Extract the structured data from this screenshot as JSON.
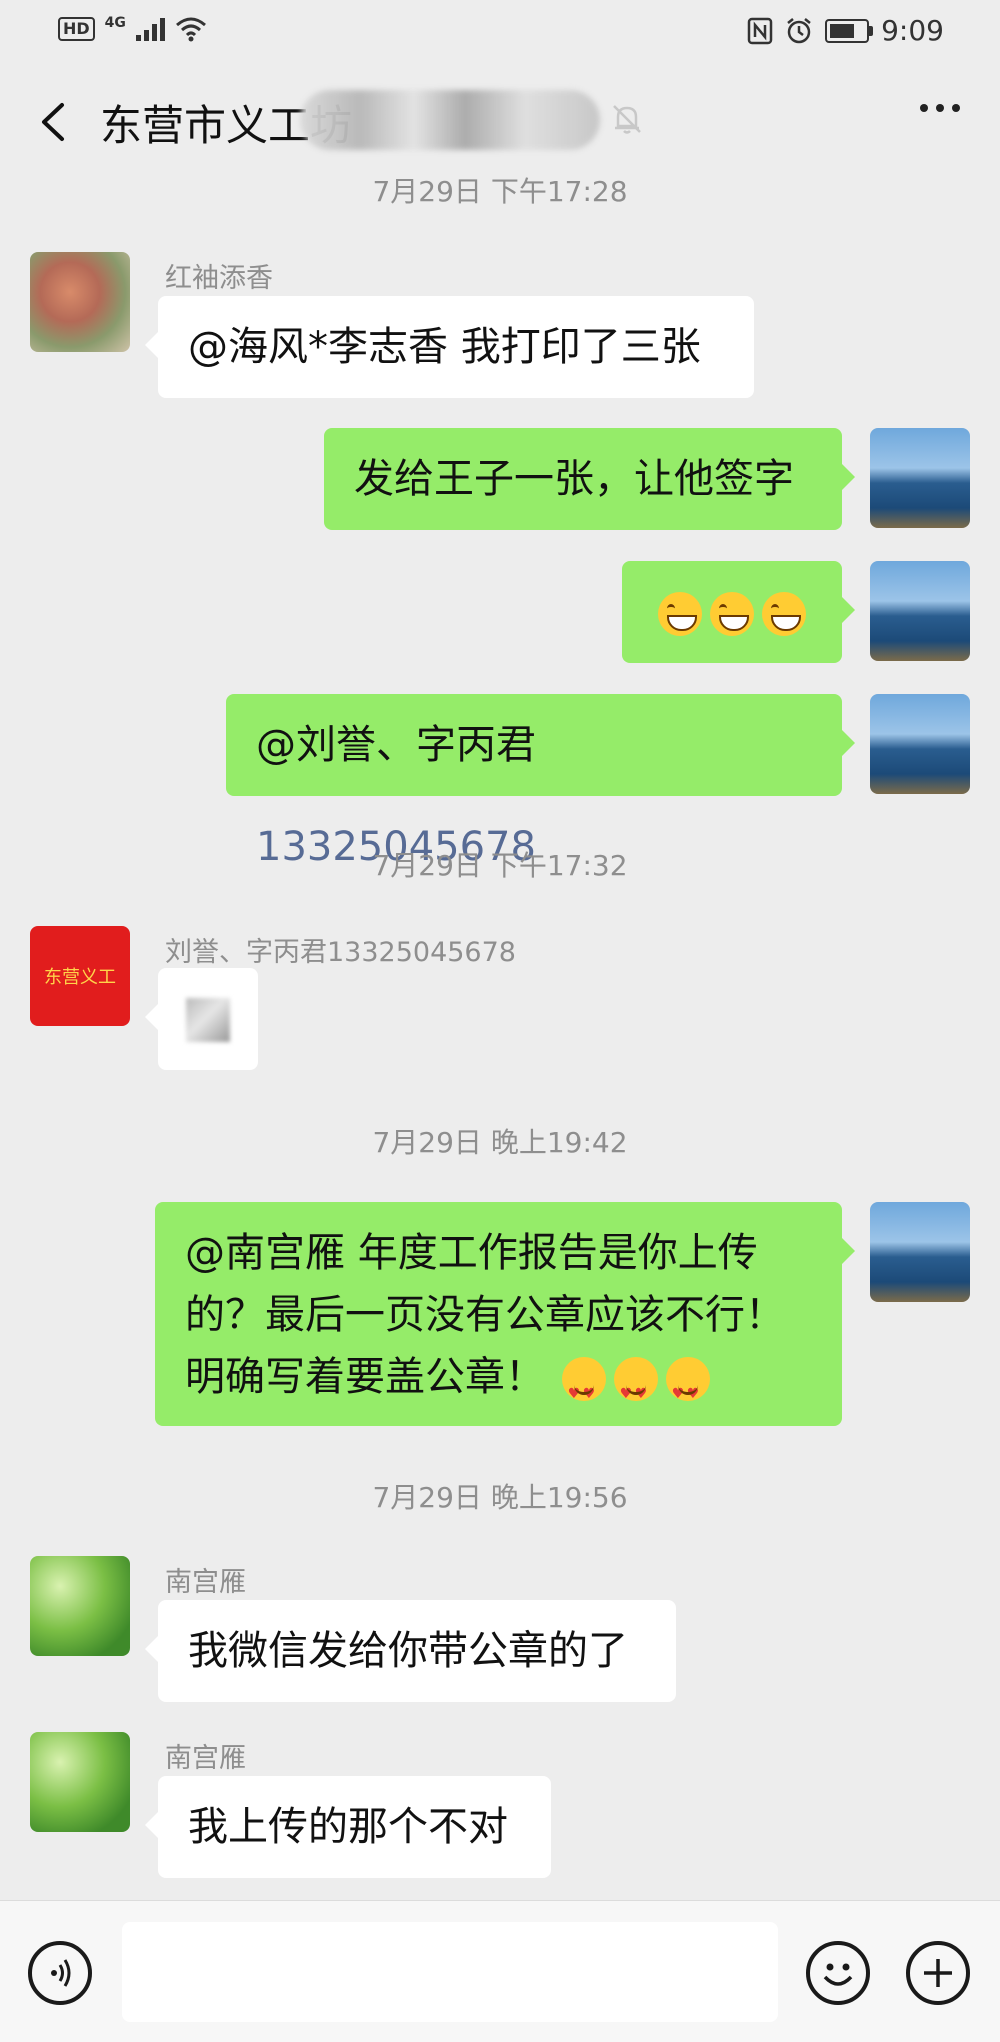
{
  "status_bar": {
    "hd": "HD",
    "network": "4G",
    "time": "9:09"
  },
  "header": {
    "title_visible": "东营市义工",
    "title_char2": "坊"
  },
  "messages": [
    {
      "type": "timestamp",
      "text": "7月29日 下午17:28"
    },
    {
      "type": "in",
      "nick": "红袖添香",
      "text": "@海风*李志香  我打印了三张"
    },
    {
      "type": "out",
      "text": "发给王子一张，让他签字"
    },
    {
      "type": "out",
      "emoji": [
        "grin",
        "grin",
        "grin"
      ]
    },
    {
      "type": "out",
      "text": "@刘誉、字丙君 ",
      "phone": "13325045678"
    },
    {
      "type": "timestamp",
      "text": "7月29日 下午17:32"
    },
    {
      "type": "in",
      "nick": "刘誉、字丙君13325045678",
      "avatar_text": "东营义工"
    },
    {
      "type": "timestamp",
      "text": "7月29日 晚上19:42"
    },
    {
      "type": "out",
      "lines": [
        "@南宫雁  年度工作报告是你上传",
        "的？最后一页没有公章应该不行！",
        "明确写着要盖公章！"
      ],
      "emoji": [
        "heart",
        "heart",
        "heart"
      ]
    },
    {
      "type": "timestamp",
      "text": "7月29日 晚上19:56"
    },
    {
      "type": "in",
      "nick": "南宫雁",
      "text": "我微信发给你带公章的了"
    },
    {
      "type": "in",
      "nick": "南宫雁",
      "text": "我上传的那个不对"
    }
  ],
  "icons": {
    "back": "back-arrow-icon",
    "bell": "mute-bell-icon",
    "more": "more-dots-icon",
    "voice": "voice-icon",
    "emoji": "emoji-icon",
    "plus": "plus-icon"
  }
}
